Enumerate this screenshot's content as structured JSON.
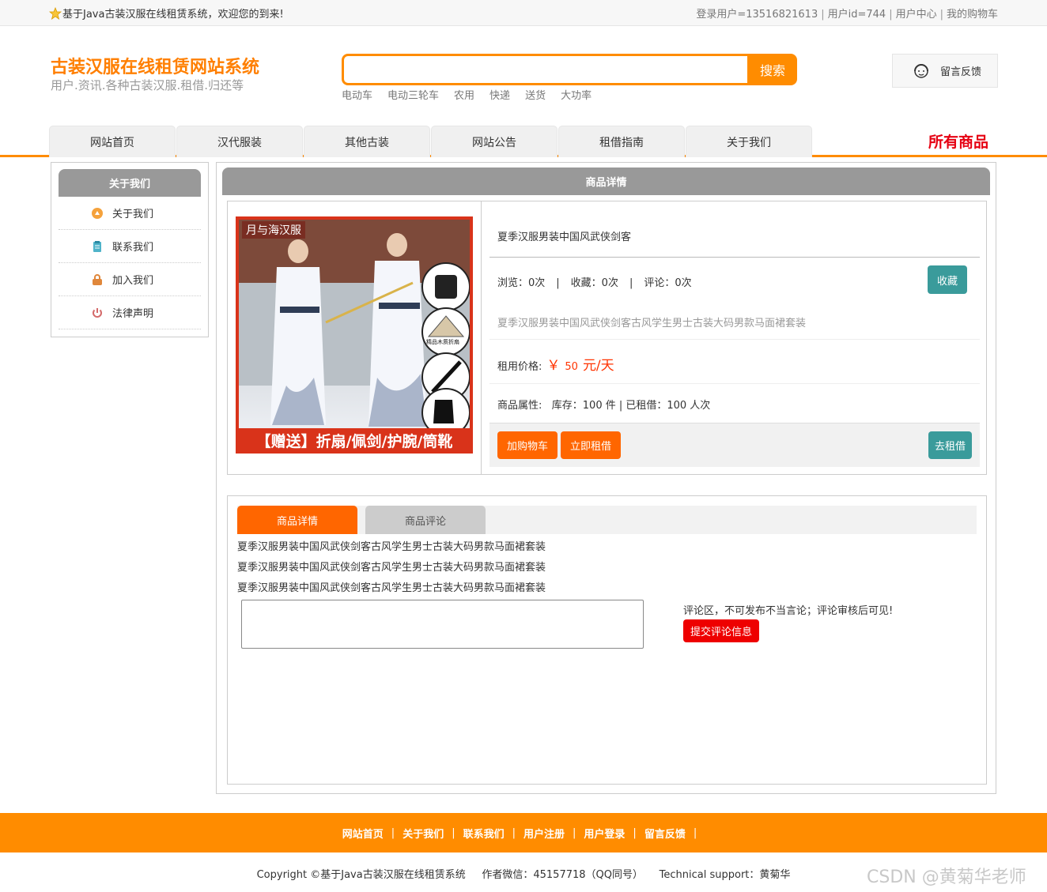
{
  "topbar": {
    "welcome": "基于Java古装汉服在线租赁系统，欢迎您的到来!",
    "login_user": "登录用户=13516821613",
    "user_id": "用户id=744",
    "user_center": "用户中心",
    "cart": "我的购物车"
  },
  "header": {
    "site_title": "古装汉服在线租赁网站系统",
    "site_subtitle": "用户.资讯.各种古装汉服.租借.归还等",
    "search_button": "搜索",
    "search_value": "",
    "hot_words": [
      "电动车",
      "电动三轮车",
      "农用",
      "快递",
      "送货",
      "大功率"
    ],
    "feedback": "留言反馈"
  },
  "nav": {
    "tabs": [
      "网站首页",
      "汉代服装",
      "其他古装",
      "网站公告",
      "租借指南",
      "关于我们"
    ],
    "all_products": "所有商品"
  },
  "sidebar": {
    "title": "关于我们",
    "items": [
      {
        "label": "关于我们",
        "icon": "about-icon",
        "color": "#f5a23c"
      },
      {
        "label": "联系我们",
        "icon": "contact-icon",
        "color": "#4fb3c9"
      },
      {
        "label": "加入我们",
        "icon": "lock-icon",
        "color": "#e0873b"
      },
      {
        "label": "法律声明",
        "icon": "power-icon",
        "color": "#d46b6b"
      }
    ]
  },
  "product": {
    "section_title": "商品详情",
    "image_banner_top": "月与海汉服",
    "image_banner_bottom": "【赠送】折扇/佩剑/护腕/筒靴",
    "image_fan_label": "精品木质折扇",
    "name": "夏季汉服男装中国风武侠剑客",
    "stats": {
      "views": "浏览：0次",
      "favorites": "收藏：0次",
      "comments": "评论：0次"
    },
    "favorite_button": "收藏",
    "description": "夏季汉服男装中国风武侠剑客古风学生男士古装大码男款马面裙套装",
    "price_label": "租用价格:",
    "price_symbol": "￥",
    "price_value": "50",
    "price_unit": "元/天",
    "attributes": "商品属性:   库存：100 件 | 已租借：100 人次",
    "add_cart_button": "加购物车",
    "rent_now_button": "立即租借",
    "go_rent_button": "去租借"
  },
  "tabs": {
    "detail_tab": "商品详情",
    "comment_tab": "商品评论",
    "detail_lines": [
      "夏季汉服男装中国风武侠剑客古风学生男士古装大码男款马面裙套装",
      "夏季汉服男装中国风武侠剑客古风学生男士古装大码男款马面裙套装",
      "夏季汉服男装中国风武侠剑客古风学生男士古装大码男款马面裙套装"
    ],
    "comment_tip": "评论区，不可发布不当言论；评论审核后可见!",
    "submit_button": "提交评论信息"
  },
  "footer": {
    "links": [
      "网站首页",
      "关于我们",
      "联系我们",
      "用户注册",
      "用户登录",
      "留言反馈"
    ],
    "copyright": "Copyright ©基于Java古装汉服在线租赁系统     作者微信：45157718（QQ同号）     Technical support：黄菊华",
    "watermark": "CSDN @黄菊华老师"
  },
  "colors": {
    "accent": "#ff8c00",
    "teal": "#3a9b9b",
    "red": "#ee0000",
    "gray_header": "#999999"
  }
}
